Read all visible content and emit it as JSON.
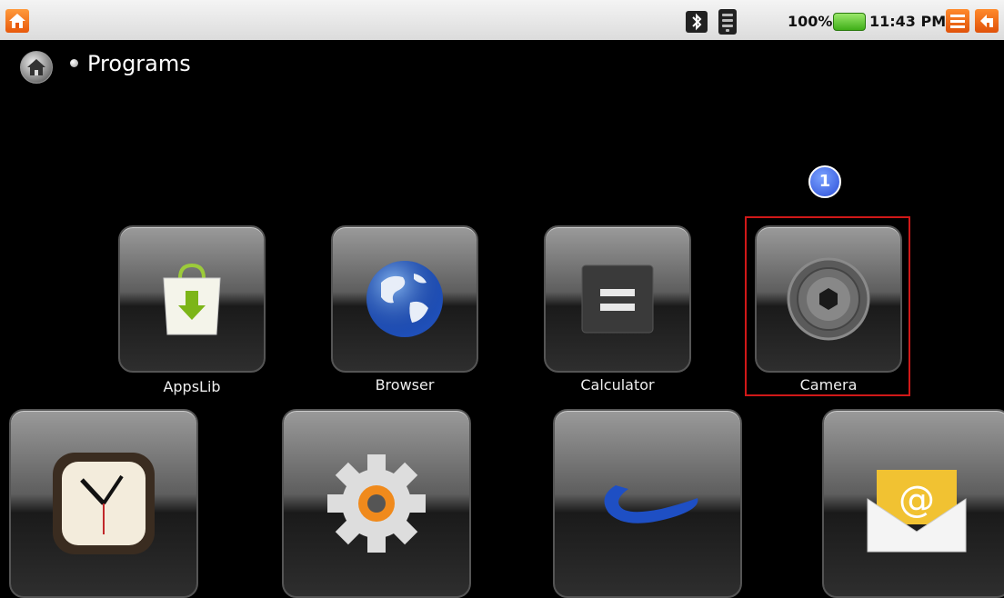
{
  "status_bar": {
    "battery_percent": "100%",
    "time": "11:43 PM",
    "icons": [
      "home-icon",
      "bluetooth-icon",
      "wifi-icon",
      "battery-icon",
      "menu-icon",
      "back-icon"
    ],
    "accent_color": "#f07820"
  },
  "breadcrumb": {
    "title": "Programs",
    "icon": "home-icon"
  },
  "annotation": {
    "badge_number": "1",
    "highlight_color": "#d01818"
  },
  "apps_row1": [
    {
      "label": "AppsLib",
      "icon": "shopping-bag-download-icon"
    },
    {
      "label": "Browser",
      "icon": "globe-icon"
    },
    {
      "label": "Calculator",
      "icon": "calculator-icon"
    },
    {
      "label": "Camera",
      "icon": "camera-aperture-icon"
    }
  ],
  "apps_row2": [
    {
      "icon": "clock-icon"
    },
    {
      "icon": "settings-gear-icon"
    },
    {
      "icon": "swoosh-logo-icon"
    },
    {
      "icon": "email-envelope-icon"
    }
  ]
}
